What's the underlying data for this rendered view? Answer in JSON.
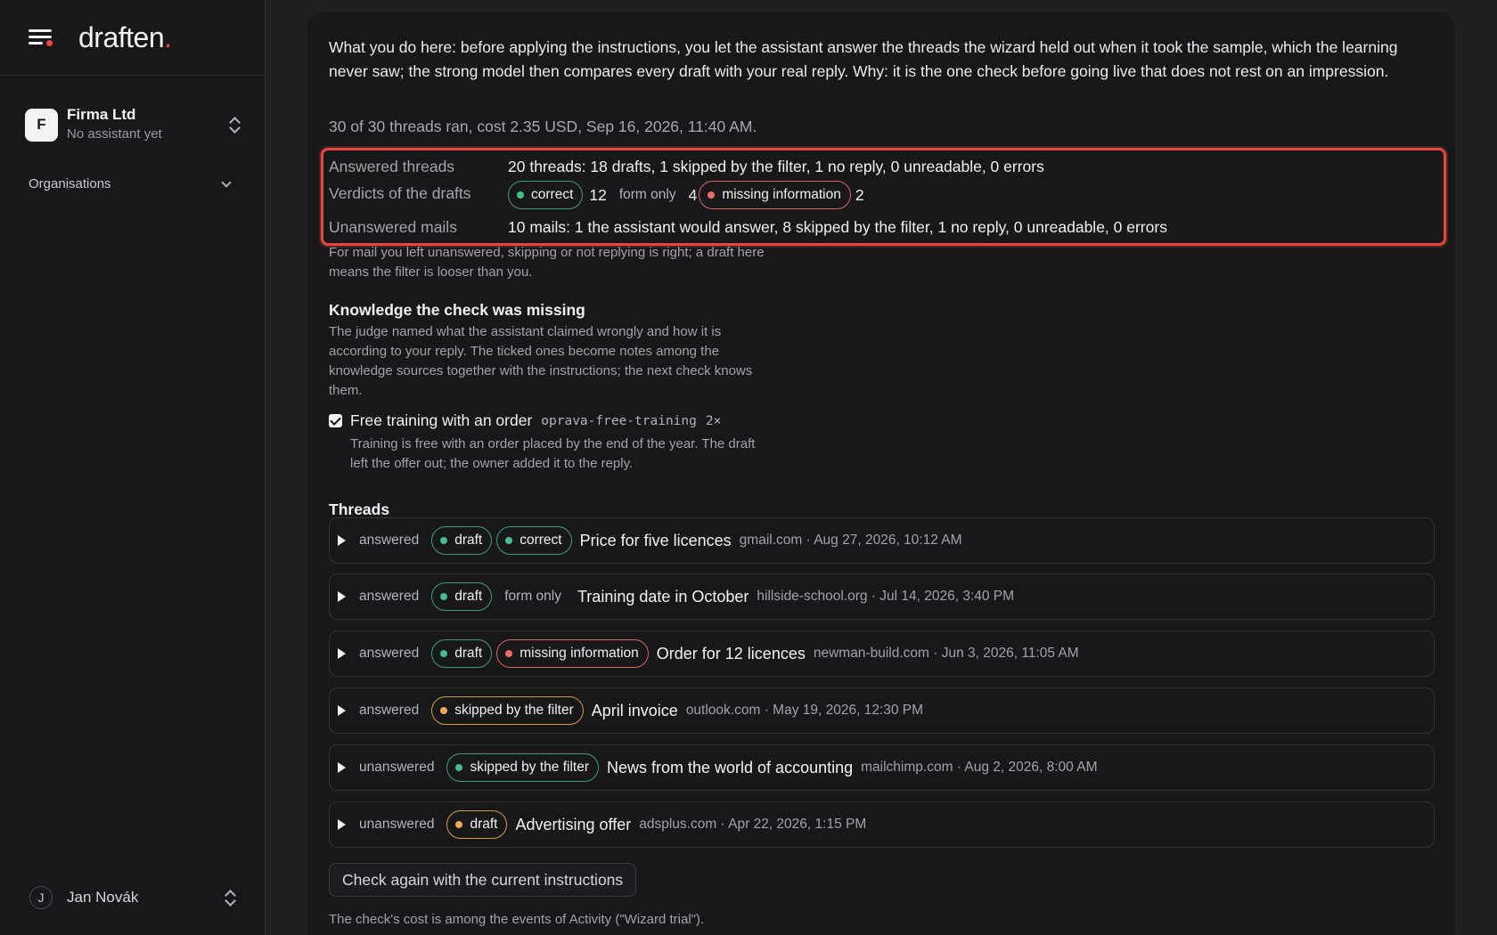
{
  "brand": {
    "logo_text": "draften",
    "logo_dot": "."
  },
  "sidebar": {
    "org": {
      "initial": "F",
      "name": "Firma Ltd",
      "subtitle": "No assistant yet"
    },
    "organisations_label": "Organisations",
    "user": {
      "initial": "J",
      "name": "Jan Novák"
    }
  },
  "intro": "What you do here: before applying the instructions, you let the assistant answer the threads the wizard held out when it took the sample, which the learning never saw; the strong model then compares every draft with your real reply. Why: it is the one check before going live that does not rest on an impression.",
  "run_info": "30 of 30 threads ran, cost 2.35 USD, Sep 16, 2026, 11:40 AM.",
  "summary": {
    "answered_label": "Answered threads",
    "answered_value": "20 threads: 18 drafts, 1 skipped by the filter, 1 no reply, 0 unreadable, 0 errors",
    "verdicts_label": "Verdicts of the drafts",
    "verdicts": {
      "correct_label": "correct",
      "correct_count": "12",
      "form_label": "form only",
      "form_count": "4",
      "missing_label": "missing information",
      "missing_count": "2"
    },
    "unanswered_label": "Unanswered mails",
    "unanswered_value": "10 mails: 1 the assistant would answer, 8 skipped by the filter, 1 no reply, 0 unreadable, 0 errors"
  },
  "hint": "For mail you left unanswered, skipping or not replying is right; a draft here means the filter is looser than you.",
  "knowledge": {
    "title": "Knowledge the check was missing",
    "description": "The judge named what the assistant claimed wrongly and how it is according to your reply. The ticked ones become notes among the knowledge sources together with the instructions; the next check knows them.",
    "note": {
      "checked": true,
      "title": "Free training with an order",
      "slug": "oprava-free-training",
      "times": "2×",
      "description": "Training is free with an order placed by the end of the year. The draft left the offer out; the owner added it to the reply."
    }
  },
  "threads_title": "Threads",
  "threads": [
    {
      "status": "answered",
      "tag1": "draft",
      "tag2": "correct",
      "subject": "Price for five licences",
      "meta": "gmail.com · Aug 27, 2026, 10:12 AM"
    },
    {
      "status": "answered",
      "tag1": "draft",
      "tag2": "form only",
      "subject": "Training date in October",
      "meta": "hillside-school.org · Jul 14, 2026, 3:40 PM"
    },
    {
      "status": "answered",
      "tag1": "draft",
      "tag2": "missing information",
      "subject": "Order for 12 licences",
      "meta": "newman-build.com · Jun 3, 2026, 11:05 AM"
    },
    {
      "status": "answered",
      "tag1": "skipped by the filter",
      "subject": "April invoice",
      "meta": "outlook.com · May 19, 2026, 12:30 PM"
    },
    {
      "status": "unanswered",
      "tag1": "skipped by the filter",
      "subject": "News from the world of accounting",
      "meta": "mailchimp.com · Aug 2, 2026, 8:00 AM"
    },
    {
      "status": "unanswered",
      "tag1": "draft",
      "subject": "Advertising offer",
      "meta": "adsplus.com · Apr 22, 2026, 1:15 PM"
    }
  ],
  "recheck_button": "Check again with the current instructions",
  "footnote": "The check's cost is among the events of Activity (\"Wizard trial\").",
  "colors": {
    "accent_red": "#e8493f",
    "green": "#43c08a",
    "red_tag": "#ef6a63",
    "orange_tag": "#f0ad48"
  }
}
